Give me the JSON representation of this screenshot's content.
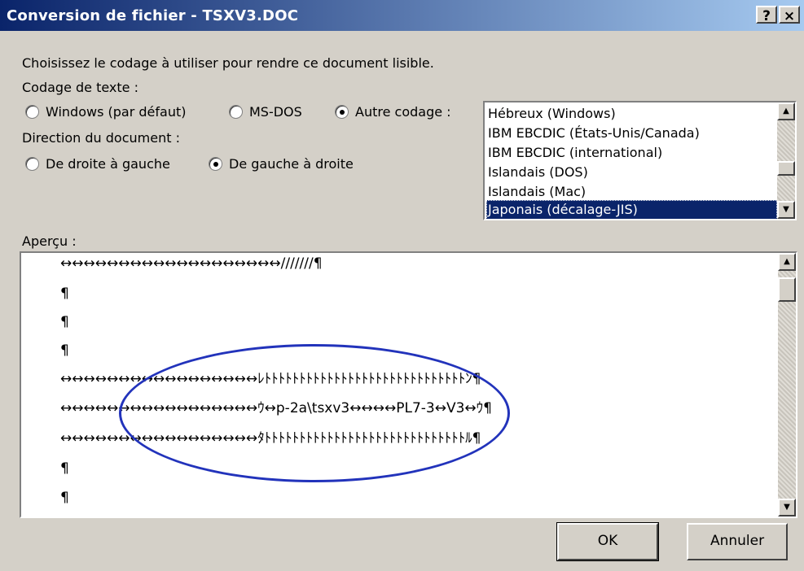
{
  "window": {
    "title": "Conversion de fichier - TSXV3.DOC",
    "help_button": "?",
    "close_button": "×"
  },
  "instructions": "Choisissez le codage à utiliser pour rendre ce document lisible.",
  "encoding": {
    "label": "Codage de texte :",
    "options": [
      {
        "label": "Windows (par défaut)",
        "selected": false
      },
      {
        "label": "MS-DOS",
        "selected": false
      },
      {
        "label": "Autre codage :",
        "selected": true
      }
    ]
  },
  "direction": {
    "label": "Direction du document :",
    "options": [
      {
        "label": "De droite à gauche",
        "selected": false
      },
      {
        "label": "De gauche à droite",
        "selected": true
      }
    ]
  },
  "encoding_list": {
    "items": [
      "Hébreux (Windows)",
      "IBM EBCDIC (États-Unis/Canada)",
      "IBM EBCDIC (international)",
      "Islandais (DOS)",
      "Islandais (Mac)",
      "Japonais (décalage-JIS)"
    ],
    "selected_index": 5
  },
  "preview": {
    "label": "Aperçu :",
    "lines": [
      "↔↔↔↔↔↔↔↔↔↔↔↔↔↔↔↔↔↔↔///////¶",
      "¶",
      "¶",
      "¶",
      "↔↔↔↔↔↔↔↔↔↔↔↔↔↔↔↔↔ﾚﾄﾄﾄﾄﾄﾄﾄﾄﾄﾄﾄﾄﾄﾄﾄﾄﾄﾄﾄﾄﾄﾄﾄﾄﾄﾄﾄﾄﾄﾝ¶",
      "↔↔↔↔↔↔↔↔↔↔↔↔↔↔↔↔↔ｳ↔p-2a\\tsxv3↔↔↔↔PL7-3↔V3↔ｳ¶",
      "↔↔↔↔↔↔↔↔↔↔↔↔↔↔↔↔↔ﾀﾄﾄﾄﾄﾄﾄﾄﾄﾄﾄﾄﾄﾄﾄﾄﾄﾄﾄﾄﾄﾄﾄﾄﾄﾄﾄﾄﾄﾄﾙ¶",
      "¶",
      "¶"
    ]
  },
  "buttons": {
    "ok": "OK",
    "cancel": "Annuler"
  },
  "colors": {
    "title_bar": "#0a246a",
    "annotation_ellipse": "#2233bb",
    "face": "#d4d0c8"
  }
}
